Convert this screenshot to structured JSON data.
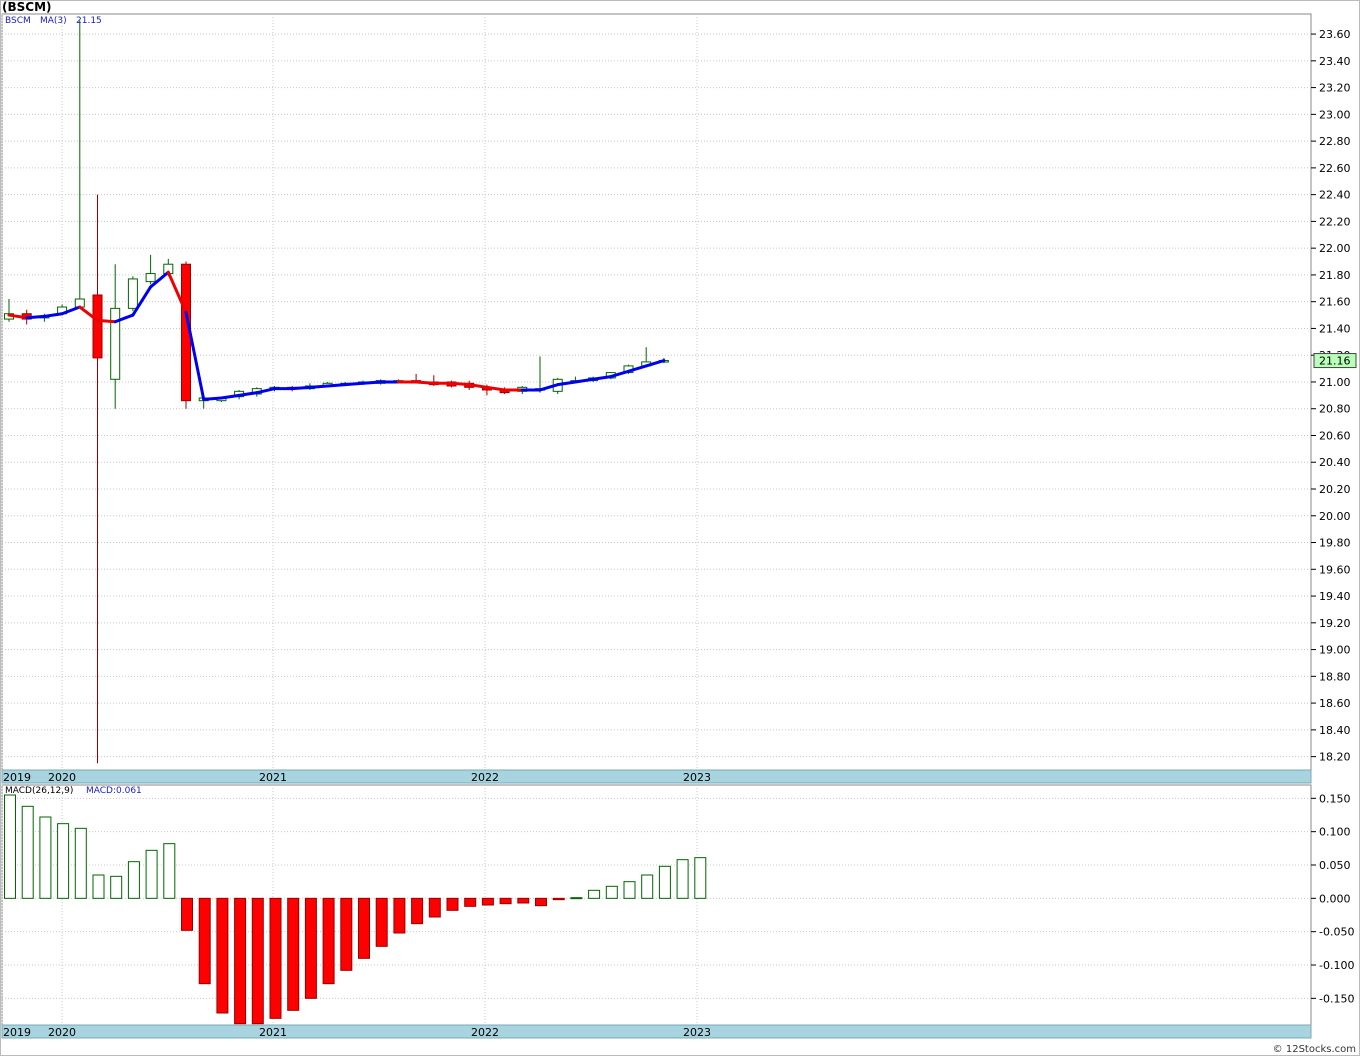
{
  "header": {
    "title": "(BSCM)"
  },
  "legend": {
    "symbol": "BSCM",
    "ma_label": "MA(3)",
    "ma_value": "21.15",
    "macd_label": "MACD(26,12,9)",
    "macd_value": "MACD:0.061"
  },
  "credit": "© 12Stocks.com",
  "colors": {
    "up_candle": "#006600",
    "down_candle": "#ff0000",
    "ma_up": "#0000ee",
    "ma_down": "#ee0000",
    "grid": "#c8c8c8",
    "axis_band": "#a8d4e0",
    "last_price_bg": "#b9ffb9"
  },
  "chart_data": [
    {
      "type": "candlestick",
      "title": "(BSCM)",
      "x_axis_labels": [
        "2019",
        "2020",
        "2021",
        "2022",
        "2023"
      ],
      "ylim": [
        18.1,
        23.75
      ],
      "y_ticks": [
        "18.20",
        "18.40",
        "18.60",
        "18.80",
        "19.00",
        "19.20",
        "19.40",
        "19.60",
        "19.80",
        "20.00",
        "20.20",
        "20.40",
        "20.60",
        "20.80",
        "21.00",
        "21.20",
        "21.40",
        "21.60",
        "21.80",
        "22.00",
        "22.20",
        "22.40",
        "22.60",
        "22.80",
        "23.00",
        "23.20",
        "23.40",
        "23.60"
      ],
      "last_price": "21.16",
      "candles": [
        {
          "o": 21.47,
          "h": 21.62,
          "l": 21.45,
          "c": 21.51
        },
        {
          "o": 21.51,
          "h": 21.54,
          "l": 21.43,
          "c": 21.47
        },
        {
          "o": 21.48,
          "h": 21.51,
          "l": 21.45,
          "c": 21.49
        },
        {
          "o": 21.51,
          "h": 21.58,
          "l": 21.5,
          "c": 21.56
        },
        {
          "o": 21.56,
          "h": 23.7,
          "l": 21.55,
          "c": 21.62
        },
        {
          "o": 21.65,
          "h": 22.4,
          "l": 18.15,
          "c": 21.18
        },
        {
          "o": 21.02,
          "h": 21.88,
          "l": 20.8,
          "c": 21.55
        },
        {
          "o": 21.55,
          "h": 21.79,
          "l": 21.53,
          "c": 21.77
        },
        {
          "o": 21.75,
          "h": 21.95,
          "l": 21.73,
          "c": 21.81
        },
        {
          "o": 21.81,
          "h": 21.92,
          "l": 21.79,
          "c": 21.88
        },
        {
          "o": 21.88,
          "h": 21.9,
          "l": 20.8,
          "c": 20.86
        },
        {
          "o": 20.86,
          "h": 20.89,
          "l": 20.8,
          "c": 20.88
        },
        {
          "o": 20.86,
          "h": 20.89,
          "l": 20.85,
          "c": 20.88
        },
        {
          "o": 20.89,
          "h": 20.94,
          "l": 20.87,
          "c": 20.93
        },
        {
          "o": 20.91,
          "h": 20.96,
          "l": 20.89,
          "c": 20.95
        },
        {
          "o": 20.95,
          "h": 20.97,
          "l": 20.93,
          "c": 20.96
        },
        {
          "o": 20.96,
          "h": 20.97,
          "l": 20.93,
          "c": 20.95
        },
        {
          "o": 20.95,
          "h": 20.99,
          "l": 20.94,
          "c": 20.97
        },
        {
          "o": 20.97,
          "h": 21.0,
          "l": 20.96,
          "c": 20.99
        },
        {
          "o": 20.98,
          "h": 21.0,
          "l": 20.97,
          "c": 20.99
        },
        {
          "o": 20.99,
          "h": 21.01,
          "l": 20.98,
          "c": 21.0
        },
        {
          "o": 20.99,
          "h": 21.02,
          "l": 20.98,
          "c": 21.01
        },
        {
          "o": 21.01,
          "h": 21.02,
          "l": 21.0,
          "c": 21.01
        },
        {
          "o": 21.01,
          "h": 21.06,
          "l": 20.99,
          "c": 21.0
        },
        {
          "o": 21.0,
          "h": 21.05,
          "l": 20.97,
          "c": 20.98
        },
        {
          "o": 21.0,
          "h": 21.01,
          "l": 20.96,
          "c": 20.97
        },
        {
          "o": 20.99,
          "h": 21.01,
          "l": 20.94,
          "c": 20.96
        },
        {
          "o": 20.96,
          "h": 20.98,
          "l": 20.9,
          "c": 20.94
        },
        {
          "o": 20.94,
          "h": 20.96,
          "l": 20.91,
          "c": 20.92
        },
        {
          "o": 20.93,
          "h": 20.97,
          "l": 20.91,
          "c": 20.96
        },
        {
          "o": 20.94,
          "h": 21.19,
          "l": 20.92,
          "c": 20.95
        },
        {
          "o": 20.93,
          "h": 21.03,
          "l": 20.91,
          "c": 21.02
        },
        {
          "o": 21.0,
          "h": 21.04,
          "l": 20.99,
          "c": 21.01
        },
        {
          "o": 21.01,
          "h": 21.04,
          "l": 21.0,
          "c": 21.03
        },
        {
          "o": 21.03,
          "h": 21.07,
          "l": 21.02,
          "c": 21.07
        },
        {
          "o": 21.07,
          "h": 21.13,
          "l": 21.06,
          "c": 21.12
        },
        {
          "o": 21.12,
          "h": 21.26,
          "l": 21.11,
          "c": 21.15
        },
        {
          "o": 21.15,
          "h": 21.18,
          "l": 21.14,
          "c": 21.16
        }
      ],
      "ma3": [
        21.5,
        21.48,
        21.49,
        21.51,
        21.56,
        21.46,
        21.45,
        21.5,
        21.71,
        21.82,
        21.52,
        20.87,
        20.88,
        20.9,
        20.92,
        20.95,
        20.95,
        20.96,
        20.97,
        20.98,
        20.99,
        21.0,
        21.0,
        21.0,
        20.99,
        20.99,
        20.98,
        20.96,
        20.94,
        20.94,
        20.94,
        20.98,
        21.0,
        21.02,
        21.04,
        21.08,
        21.12,
        21.16
      ],
      "ma3_color": [
        "down",
        "down",
        "up",
        "up",
        "up",
        "down",
        "down",
        "up",
        "up",
        "up",
        "down",
        "up",
        "up",
        "up",
        "up",
        "up",
        "up",
        "up",
        "up",
        "up",
        "up",
        "up",
        "up",
        "down",
        "down",
        "down",
        "down",
        "down",
        "down",
        "down",
        "up",
        "up",
        "up",
        "up",
        "up",
        "up",
        "up",
        "up"
      ]
    },
    {
      "type": "bar",
      "title": "MACD(26,12,9)",
      "ylim": [
        -0.19,
        0.17
      ],
      "y_ticks": [
        "0.150",
        "0.100",
        "0.050",
        "0.000",
        "-0.050",
        "-0.100",
        "-0.150"
      ],
      "values": [
        0.155,
        0.138,
        0.122,
        0.112,
        0.105,
        0.035,
        0.033,
        0.055,
        0.072,
        0.082,
        -0.048,
        -0.128,
        -0.172,
        -0.188,
        -0.188,
        -0.18,
        -0.168,
        -0.15,
        -0.128,
        -0.108,
        -0.09,
        -0.072,
        -0.052,
        -0.038,
        -0.028,
        -0.018,
        -0.012,
        -0.01,
        -0.008,
        -0.007,
        -0.011,
        -0.002,
        0.001,
        0.012,
        0.018,
        0.025,
        0.035,
        0.048,
        0.058,
        0.061
      ]
    }
  ]
}
